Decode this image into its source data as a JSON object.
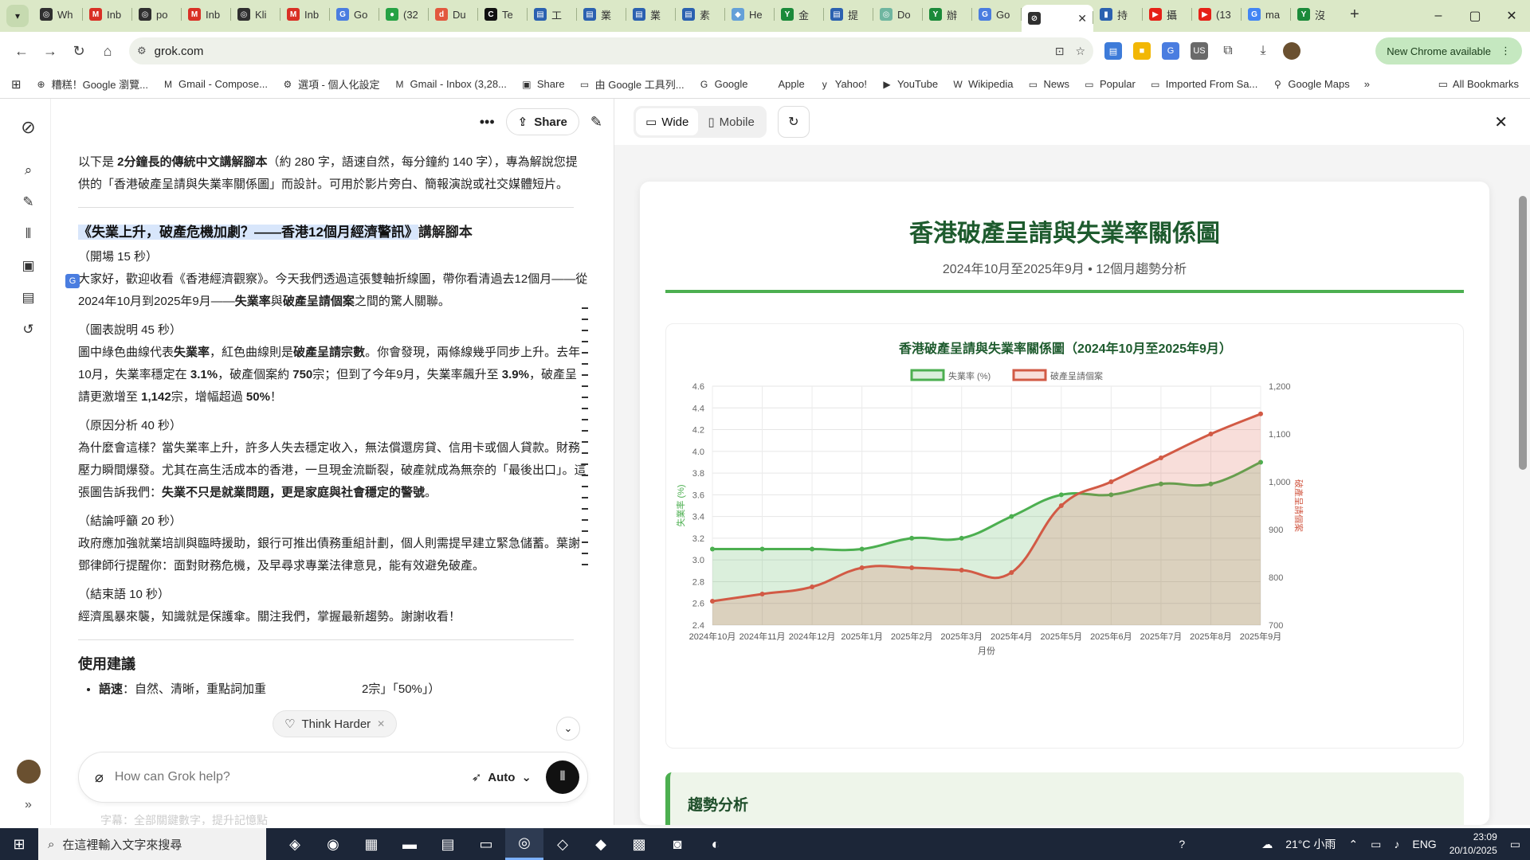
{
  "tabs": [
    {
      "label": "Wh",
      "c": "#2f2f2f",
      "g": "◎"
    },
    {
      "label": "Inb",
      "c": "#d93025",
      "g": "M"
    },
    {
      "label": "po",
      "c": "#2f2f2f",
      "g": "◎"
    },
    {
      "label": "Inb",
      "c": "#d93025",
      "g": "M"
    },
    {
      "label": "Kli",
      "c": "#2f2f2f",
      "g": "◎"
    },
    {
      "label": "Inb",
      "c": "#d93025",
      "g": "M"
    },
    {
      "label": "Go",
      "c": "#4a7de0",
      "g": "G"
    },
    {
      "label": "(32",
      "c": "#25a244",
      "g": "●"
    },
    {
      "label": "Du",
      "c": "#e2583e",
      "g": "d"
    },
    {
      "label": "Te",
      "c": "#111",
      "g": "C"
    },
    {
      "label": "工",
      "c": "#2b61b0",
      "g": "▤"
    },
    {
      "label": "業",
      "c": "#2b61b0",
      "g": "▤"
    },
    {
      "label": "業",
      "c": "#2b61b0",
      "g": "▤"
    },
    {
      "label": "素",
      "c": "#2b61b0",
      "g": "▤"
    },
    {
      "label": "He",
      "c": "#64a0d8",
      "g": "◆"
    },
    {
      "label": "金",
      "c": "#1b8a3a",
      "g": "Y"
    },
    {
      "label": "提",
      "c": "#2b61b0",
      "g": "▤"
    },
    {
      "label": "Do",
      "c": "#6fb6a0",
      "g": "◎"
    },
    {
      "label": "辦",
      "c": "#1b8a3a",
      "g": "Y"
    },
    {
      "label": "Go",
      "c": "#4a7de0",
      "g": "G"
    },
    {
      "label": "",
      "c": "#2f2f2f",
      "g": "⊘",
      "active": true
    },
    {
      "label": "持",
      "c": "#2b61b0",
      "g": "▮"
    },
    {
      "label": "攝",
      "c": "#e62117",
      "g": "▶"
    },
    {
      "label": "(13",
      "c": "#e62117",
      "g": "▶"
    },
    {
      "label": "ma",
      "c": "#4285f4",
      "g": "G"
    },
    {
      "label": "沒",
      "c": "#1b8a3a",
      "g": "Y"
    }
  ],
  "toolbar": {
    "url": "grok.com",
    "update": "New Chrome available"
  },
  "bookmarks": [
    {
      "label": "糟糕！Google 瀏覽...",
      "g": "⊕"
    },
    {
      "label": "Gmail - Compose...",
      "g": "M"
    },
    {
      "label": "選項 - 個人化設定",
      "g": "⚙"
    },
    {
      "label": "Gmail - Inbox (3,28...",
      "g": "M"
    },
    {
      "label": "Share",
      "g": "▣"
    },
    {
      "label": "由 Google 工具列...",
      "g": "▭"
    },
    {
      "label": "Google",
      "g": "G"
    },
    {
      "label": "Apple",
      "g": ""
    },
    {
      "label": "Yahoo!",
      "g": "y"
    },
    {
      "label": "YouTube",
      "g": "▶"
    },
    {
      "label": "Wikipedia",
      "g": "W"
    },
    {
      "label": "News",
      "g": "▭"
    },
    {
      "label": "Popular",
      "g": "▭"
    },
    {
      "label": "Imported From Sa...",
      "g": "▭"
    },
    {
      "label": "Google Maps",
      "g": "⚲"
    }
  ],
  "all_bookmarks": "All Bookmarks",
  "chat": {
    "share": "Share",
    "intro": [
      "以下是 ",
      "2分鐘長的傳統中文講解腳本",
      "（約 280 字，語速自然，每分鐘約 140 字），專為解說您提供的「香港破產呈請與失業率關係圖」而設計。可用於影片旁白、簡報演說或社交媒體短片。"
    ],
    "script_title": "《失業上升，破產危機加劇？——香港12個月經濟警訊》",
    "script_title_tail": "講解腳本",
    "s1_head": "（開場 15 秒）",
    "s1": [
      "大家好，歡迎收看《香港經濟觀察》。今天我們透過這張雙軸折線圖，帶你看清過去12個月——從2024年10月到2025年9月——",
      "失業率",
      "與",
      "破產呈請個案",
      "之間的驚人關聯。"
    ],
    "s2_head": "（圖表說明 45 秒）",
    "s2": [
      "圖中綠色曲線代表",
      "失業率",
      "，紅色曲線則是",
      "破產呈請宗數",
      "。你會發現，兩條線幾乎同步上升。去年10月，失業率穩定在 ",
      "3.1%",
      "，破產個案約 ",
      "750",
      "宗；但到了今年9月，失業率飆升至 ",
      "3.9%",
      "，破產呈請更激增至 ",
      "1,142",
      "宗，增幅超過 ",
      "50%",
      "！"
    ],
    "s3_head": "（原因分析 40 秒）",
    "s3": [
      "為什麼會這樣？當失業率上升，許多人失去穩定收入，無法償還房貸、信用卡或個人貸款。財務壓力瞬間爆發。尤其在高生活成本的香港，一旦現金流斷裂，破產就成為無奈的「最後出口」。這張圖告訴我們：",
      "失業不只是就業問題，更是家庭與社會穩定的警號",
      "。"
    ],
    "s4_head": "（結論呼籲 20 秒）",
    "s4": "政府應加強就業培訓與臨時援助，銀行可推出債務重組計劃，個人則需提早建立緊急儲蓄。葉謝鄧律師行提醒你：面對財務危機，及早尋求專業法律意見，能有效避免破產。",
    "s5_head": "（結束語 10 秒）",
    "s5": "經濟風暴來襲，知識就是保護傘。關注我們，掌握最新趨勢。謝謝收看！",
    "usage_title": "使用建議",
    "usage_item_label": "語速",
    "usage_item_text": "：自然、清晰，重點詞加重",
    "usage_item_tail": "2宗」「50%」）",
    "think_harder": "Think Harder",
    "placeholder": "How can Grok help?",
    "mode": "Auto",
    "ghost": "字幕：全部關鍵數字，提升記憶點"
  },
  "preview": {
    "wide": "Wide",
    "mobile": "Mobile",
    "title": "香港破產呈請與失業率關係圖",
    "subtitle": "2024年10月至2025年9月 • 12個月趨勢分析",
    "trend_title": "趨勢分析"
  },
  "chart_data": {
    "type": "line",
    "title": "香港破產呈請與失業率關係圖（2024年10月至2025年9月）",
    "categories": [
      "2024年10月",
      "2024年11月",
      "2024年12月",
      "2025年1月",
      "2025年2月",
      "2025年3月",
      "2025年4月",
      "2025年5月",
      "2025年6月",
      "2025年7月",
      "2025年8月",
      "2025年9月"
    ],
    "xlabel": "月份",
    "series": [
      {
        "name": "失業率 (%)",
        "axis": "left",
        "color": "#4caf50",
        "fill": "rgba(76,175,80,0.2)",
        "values": [
          3.1,
          3.1,
          3.1,
          3.1,
          3.2,
          3.2,
          3.4,
          3.6,
          3.6,
          3.7,
          3.7,
          3.9
        ]
      },
      {
        "name": "破產呈請個案",
        "axis": "right",
        "color": "#d25a45",
        "fill": "rgba(220,90,70,0.2)",
        "values": [
          750,
          765,
          780,
          820,
          820,
          815,
          810,
          950,
          1000,
          1050,
          1100,
          1142
        ]
      }
    ],
    "ylabel_left": "失業率 (%)",
    "ylim_left": [
      2.4,
      4.6
    ],
    "yticks_left": [
      "2.4",
      "2.6",
      "2.8",
      "3.0",
      "3.2",
      "3.4",
      "3.6",
      "3.8",
      "4.0",
      "4.2",
      "4.4",
      "4.6"
    ],
    "ylabel_right": "破產呈請個案",
    "ylim_right": [
      700,
      1200
    ],
    "yticks_right": [
      "700",
      "800",
      "900",
      "1,000",
      "1,100",
      "1,200"
    ],
    "grid": true,
    "legend": "top"
  },
  "taskbar": {
    "search": "在這裡輸入文字來搜尋",
    "weather": "21°C 小雨",
    "lang": "ENG",
    "time": "23:09",
    "date": "20/10/2025"
  }
}
